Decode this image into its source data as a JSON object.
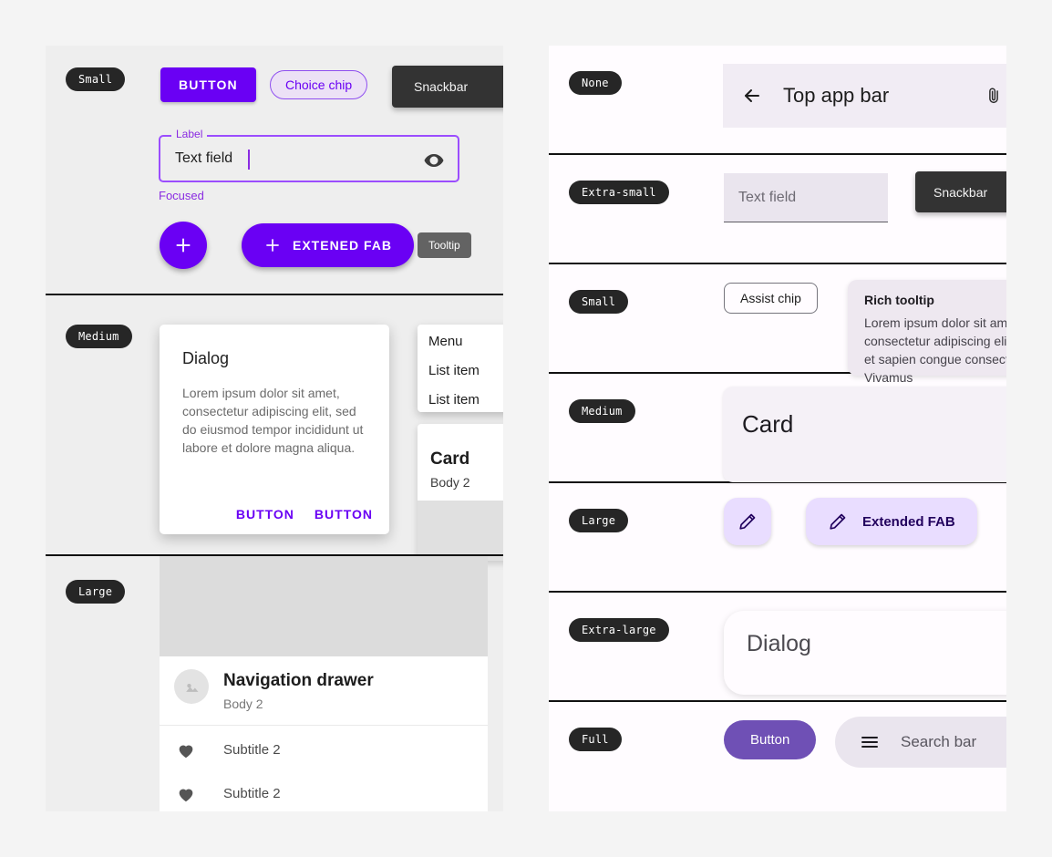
{
  "left_panel": {
    "rows": [
      {
        "size_label": "Small",
        "button_label": "BUTTON",
        "choice_chip_label": "Choice chip",
        "snackbar_label": "Snackbar",
        "textfield": {
          "label": "Label",
          "value": "Text field",
          "helper": "Focused",
          "trailing_icon": "eye-icon"
        },
        "fab_icon": "plus-icon",
        "extended_fab_label": "EXTENED FAB",
        "extended_fab_icon": "plus-icon",
        "tooltip_label": "Tooltip"
      },
      {
        "size_label": "Medium",
        "dialog": {
          "title": "Dialog",
          "body": "Lorem ipsum dolor sit amet, consectetur adipiscing elit, sed do eiusmod tempor incididunt ut labore et dolore magna aliqua.",
          "action_left": "BUTTON",
          "action_right": "BUTTON"
        },
        "menu": {
          "items": [
            "Menu",
            "List item",
            "List item"
          ]
        },
        "card": {
          "title": "Card",
          "body": "Body 2"
        }
      },
      {
        "size_label": "Large",
        "nav_drawer": {
          "title": "Navigation drawer",
          "subtitle": "Body 2",
          "avatar_icon": "avatar-image-icon",
          "items": [
            {
              "icon": "heart-icon",
              "label": "Subtitle 2"
            },
            {
              "icon": "heart-icon",
              "label": "Subtitle 2"
            }
          ]
        }
      }
    ]
  },
  "right_panel": {
    "rows": [
      {
        "size_label": "None",
        "top_app_bar": {
          "back_icon": "arrow-left-icon",
          "title": "Top app bar",
          "trailing_icon": "paperclip-icon"
        }
      },
      {
        "size_label": "Extra-small",
        "textfield_placeholder": "Text field",
        "snackbar_label": "Snackbar"
      },
      {
        "size_label": "Small",
        "assist_chip_label": "Assist chip",
        "rich_tooltip": {
          "title": "Rich tooltip",
          "body": "Lorem ipsum dolor sit amet, consectetur adipiscing elit. Nullam et sapien congue consectetur. Vivamus"
        }
      },
      {
        "size_label": "Medium",
        "card_title": "Card"
      },
      {
        "size_label": "Large",
        "fab_icon": "pencil-icon",
        "extended_fab_label": "Extended FAB",
        "extended_fab_icon": "pencil-icon"
      },
      {
        "size_label": "Extra-large",
        "dialog_title": "Dialog"
      },
      {
        "size_label": "Full",
        "button_label": "Button",
        "search_bar": {
          "menu_icon": "hamburger-menu-icon",
          "placeholder": "Search bar"
        }
      }
    ]
  },
  "colors": {
    "page_bg": "#f4f4f4",
    "left_panel_bg": "#eeeeee",
    "right_panel_bg": "#fffcff",
    "primary_purple": "#6a00f4",
    "light_purple_container": "#e9ddff",
    "on_purple_container": "#21005d",
    "pill_dark": "#262626",
    "snackbar_dark": "#333333",
    "tooltip_gray": "#636363",
    "full_button_purple": "#6f50b5"
  }
}
